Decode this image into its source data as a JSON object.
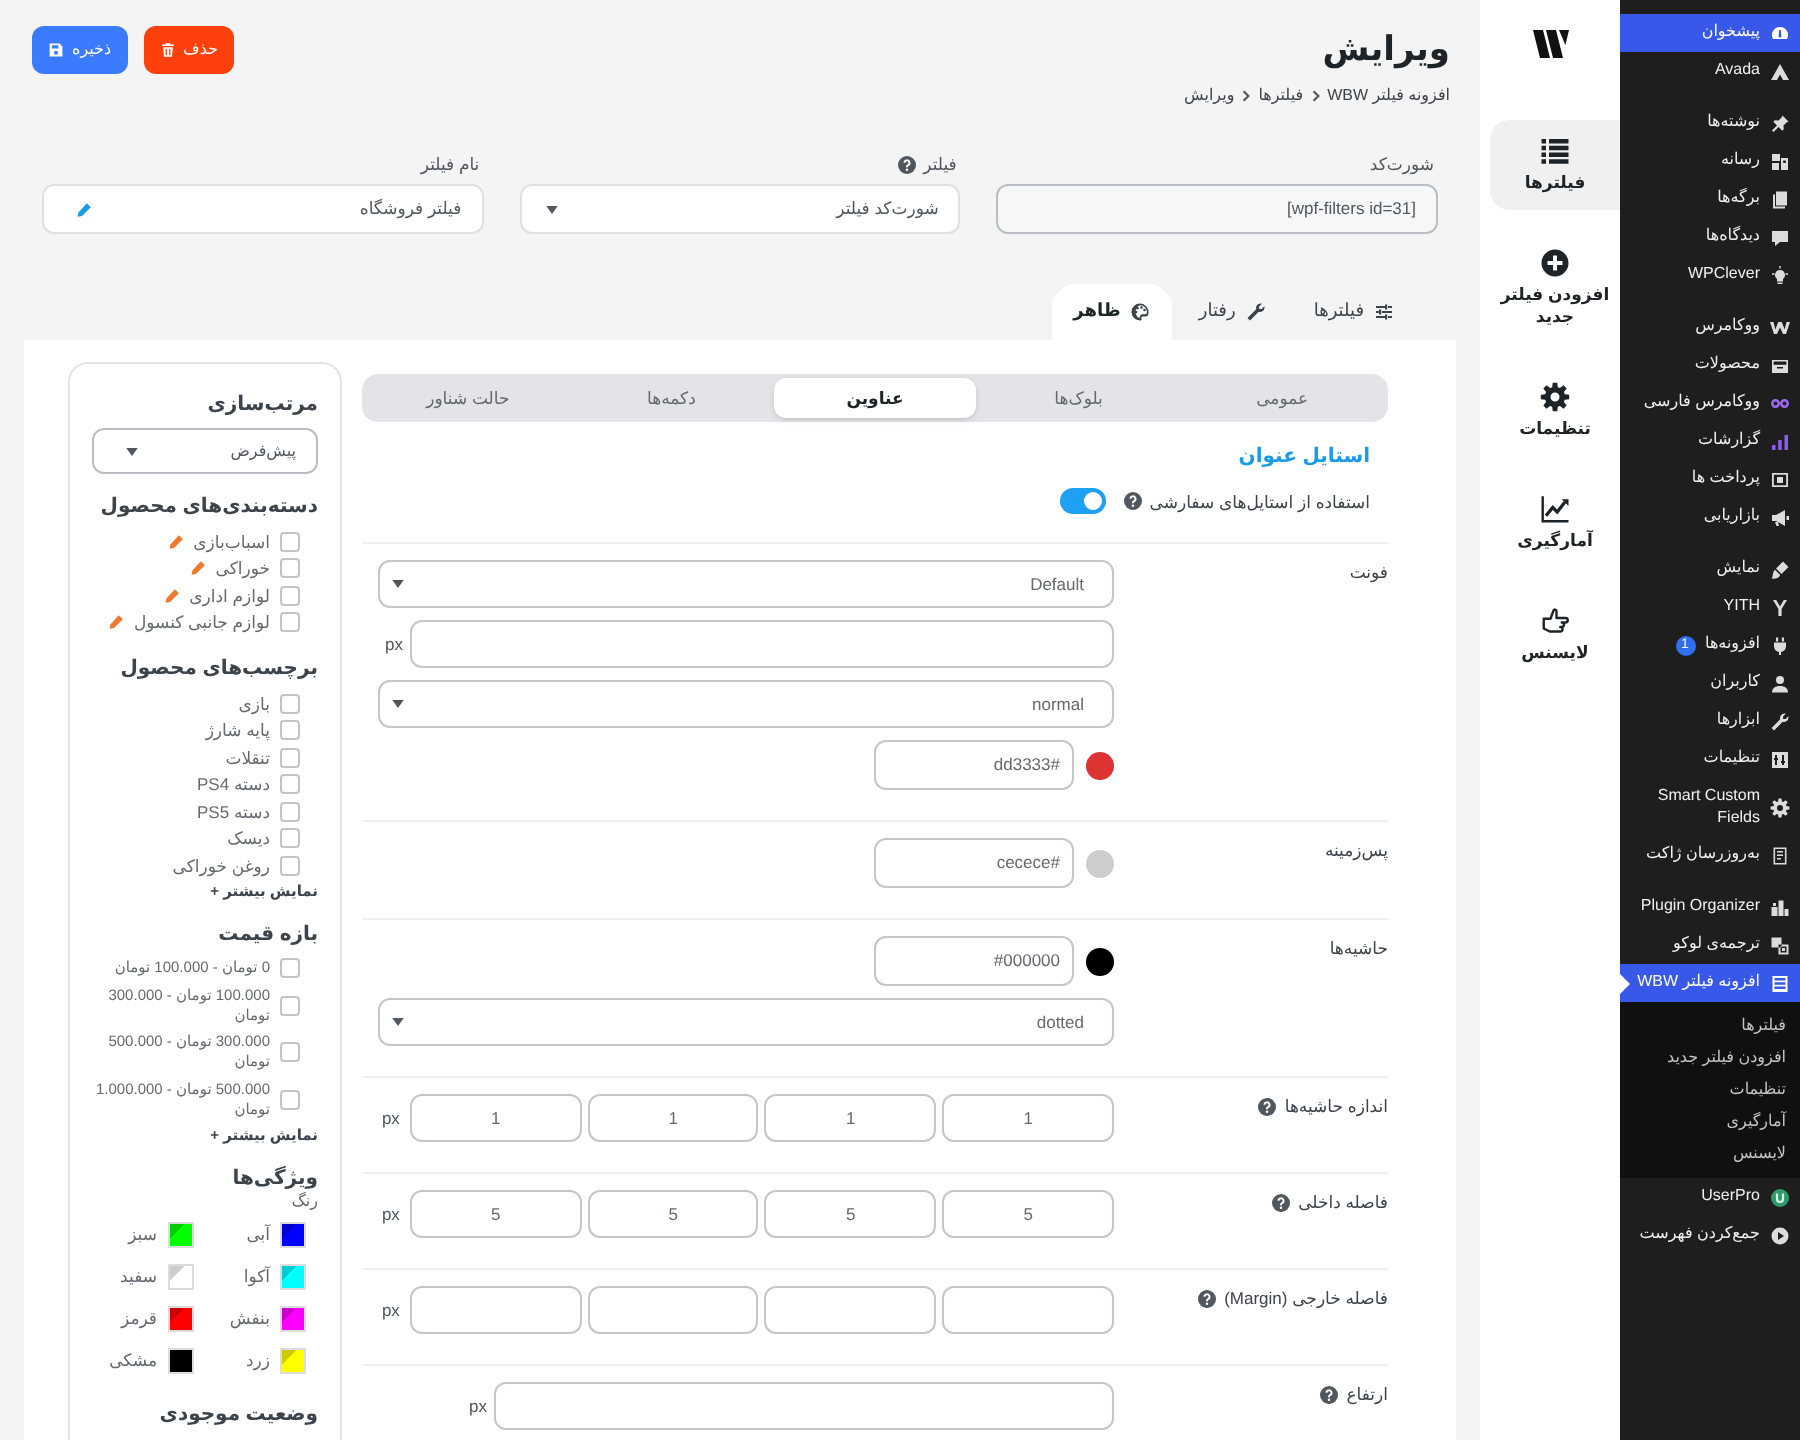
{
  "admin_menu": {
    "groups": [
      [
        {
          "label": "پیشخوان",
          "selected": true
        },
        {
          "label": "Avada",
          "selected": false
        }
      ],
      [
        {
          "label": "نوشته‌ها",
          "selected": false
        },
        {
          "label": "رسانه",
          "selected": false
        },
        {
          "label": "برگه‌ها",
          "selected": false
        },
        {
          "label": "دیدگاه‌ها",
          "selected": false
        },
        {
          "label": "WPClever",
          "selected": false
        }
      ],
      [
        {
          "label": "ووکامرس",
          "selected": false
        },
        {
          "label": "محصولات",
          "selected": false
        },
        {
          "label": "ووکامرس فارسی",
          "selected": false
        },
        {
          "label": "گزارشات",
          "selected": false
        },
        {
          "label": "پرداخت ها",
          "selected": false
        },
        {
          "label": "بازاریابی",
          "selected": false
        }
      ],
      [
        {
          "label": "نمایش",
          "selected": false
        },
        {
          "label": "YITH",
          "selected": false
        },
        {
          "label": "افزونه‌ها",
          "selected": false,
          "badge": "1"
        },
        {
          "label": "کاربران",
          "selected": false
        },
        {
          "label": "ابزارها",
          "selected": false
        },
        {
          "label": "تنظیمات",
          "selected": false
        },
        {
          "label": "Smart Custom Fields",
          "selected": false
        },
        {
          "label": "به‌روزرسان ژاکت",
          "selected": false
        }
      ],
      [
        {
          "label": "Plugin Organizer",
          "selected": false
        },
        {
          "label": "ترجمه‌ی لوکو",
          "selected": false
        },
        {
          "label": "افزونه فیلتر WBW",
          "selected": true,
          "submenu": [
            {
              "label": "فیلترها",
              "selected": false
            },
            {
              "label": "افزودن فیلتر جدید",
              "selected": false
            },
            {
              "label": "تنظیمات",
              "selected": false
            },
            {
              "label": "آمارگیری",
              "selected": false
            },
            {
              "label": "لایسنس",
              "selected": false
            }
          ]
        },
        {
          "label": "UserPro",
          "selected": false
        },
        {
          "label": "جمع‌کردن فهرست",
          "selected": false
        }
      ]
    ]
  },
  "plugin_nav": {
    "items": [
      {
        "label": "فیلترها",
        "selected": true
      },
      {
        "label": "افزودن فیلتر جدید",
        "selected": false
      },
      {
        "label": "تنظیمات",
        "selected": false
      },
      {
        "label": "آمارگیری",
        "selected": false
      },
      {
        "label": "لایسنس",
        "selected": false
      }
    ]
  },
  "header": {
    "title": "ویرایش",
    "breadcrumb": [
      "افزونه فیلتر WBW",
      "فیلترها",
      "ویرایش"
    ],
    "buttons": [
      {
        "label": "حذف",
        "kind": "danger"
      },
      {
        "label": "ذخیره",
        "kind": "primary"
      }
    ]
  },
  "fields": [
    {
      "kind": "readonly",
      "label": "شورت‌کد",
      "value": "[wpf-filters id=31]"
    },
    {
      "kind": "select",
      "label": "فیلتر",
      "help": true,
      "value": "شورت‌کد فیلتر"
    },
    {
      "kind": "editable",
      "label": "نام فیلتر",
      "value": "فیلتر فروشگاه"
    }
  ],
  "tabs": [
    {
      "label": "فیلترها",
      "selected": false
    },
    {
      "label": "رفتار",
      "selected": false
    },
    {
      "label": "ظاهر",
      "selected": true
    }
  ],
  "subtabs": [
    {
      "label": "عمومی",
      "selected": false
    },
    {
      "label": "بلوک‌ها",
      "selected": false
    },
    {
      "label": "عناوین",
      "selected": true
    },
    {
      "label": "دکمه‌ها",
      "selected": false
    },
    {
      "label": "حالت شناور",
      "selected": false
    }
  ],
  "form": {
    "section_title": "استایل عنوان",
    "rows": [
      {
        "kind": "toggle",
        "label": "استفاده از استایل‌های سفارشی",
        "help": true,
        "on": true
      },
      {
        "kind": "fields",
        "label": "فونت",
        "controls": [
          {
            "kind": "select",
            "value": "Default"
          },
          {
            "kind": "unit",
            "unit": "px"
          },
          {
            "kind": "select",
            "value": "normal"
          },
          {
            "kind": "color",
            "color": "#dd3333",
            "value": "#dd3333"
          }
        ]
      },
      {
        "kind": "fields",
        "label": "پس‌زمینه",
        "controls": [
          {
            "kind": "color",
            "color": "#cecece",
            "value": "#cecece"
          }
        ]
      },
      {
        "kind": "fields",
        "label": "حاشیه‌ها",
        "controls": [
          {
            "kind": "color",
            "color": "#000000",
            "value": "#000000"
          },
          {
            "kind": "select",
            "value": "dotted"
          }
        ]
      },
      {
        "kind": "fields",
        "label": "اندازه حاشیه‌ها",
        "help": true,
        "controls": [
          {
            "kind": "quad",
            "unit": "px",
            "values": [
              "1",
              "1",
              "1",
              "1"
            ]
          }
        ]
      },
      {
        "kind": "fields",
        "label": "فاصله داخلی",
        "help": true,
        "controls": [
          {
            "kind": "quad",
            "unit": "px",
            "values": [
              "5",
              "5",
              "5",
              "5"
            ]
          }
        ]
      },
      {
        "kind": "fields",
        "label": "فاصله خارجی (Margin)",
        "help": true,
        "controls": [
          {
            "kind": "blankquad",
            "unit": "px"
          }
        ]
      },
      {
        "kind": "fields",
        "label": "ارتفاع",
        "help": true,
        "controls": [
          {
            "kind": "narrowunit",
            "unit": "px"
          }
        ]
      }
    ]
  },
  "preview": {
    "blocks": [
      {
        "kind": "select",
        "title": "مرتب‌سازی",
        "value": "پیش‌فرض"
      },
      {
        "kind": "categories",
        "title": "دسته‌بندی‌های محصول",
        "items": [
          {
            "label": "اسباب‌بازی",
            "checked": false
          },
          {
            "label": "خوراکی",
            "checked": false
          },
          {
            "label": "لوازم اداری",
            "checked": false
          },
          {
            "label": "لوازم جانبی کنسول",
            "checked": false
          }
        ]
      },
      {
        "kind": "checklist",
        "title": "برچسب‌های محصول",
        "items": [
          {
            "label": "بازی",
            "checked": false
          },
          {
            "label": "پایه شارژ",
            "checked": false
          },
          {
            "label": "تنقلات",
            "checked": false
          },
          {
            "label": "دسته PS4",
            "checked": false
          },
          {
            "label": "دسته PS5",
            "checked": false
          },
          {
            "label": "دیسک",
            "checked": false
          },
          {
            "label": "روغن خوراکی",
            "checked": false
          }
        ],
        "more": "نمایش بیشتر +"
      },
      {
        "kind": "ranges",
        "title": "بازه قیمت",
        "items": [
          {
            "label": "0 تومان - 100.000 تومان",
            "checked": false
          },
          {
            "label": "100.000 تومان - 300.000 تومان",
            "checked": false
          },
          {
            "label": "300.000 تومان - 500.000 تومان",
            "checked": false
          },
          {
            "label": "500.000 تومان - 1.000.000 تومان",
            "checked": false
          }
        ],
        "more": "نمایش بیشتر +"
      },
      {
        "kind": "swatches",
        "title": "ویژگی‌ها",
        "subtitle": "رنگ",
        "items": [
          {
            "label": "آبی",
            "color": "#0000ff"
          },
          {
            "label": "سبز",
            "color": "#00ff00"
          },
          {
            "label": "آکوا",
            "color": "#00ffff"
          },
          {
            "label": "سفید",
            "color": "#ffffff"
          },
          {
            "label": "بنفش",
            "color": "#ff00ff"
          },
          {
            "label": "قرمز",
            "color": "#ff0000"
          },
          {
            "label": "زرد",
            "color": "#ffff00"
          },
          {
            "label": "مشکی",
            "color": "#000000"
          }
        ]
      },
      {
        "kind": "heading",
        "title": "وضعیت موجودی"
      }
    ]
  }
}
